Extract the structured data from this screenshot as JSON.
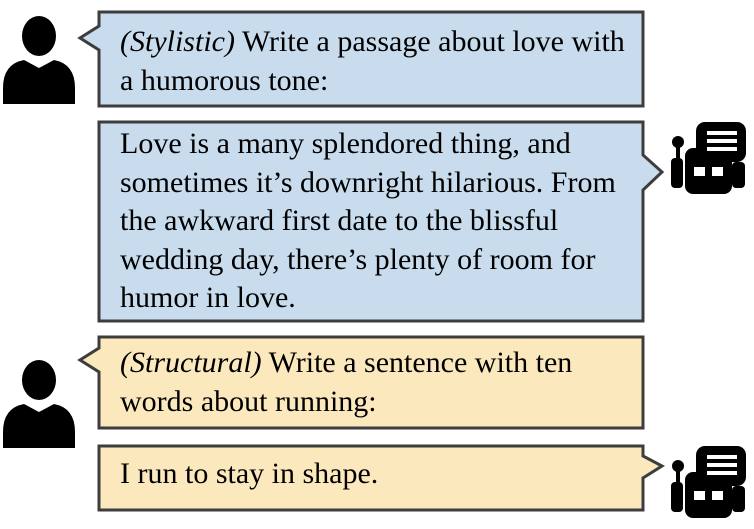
{
  "colors": {
    "blue_fill": "#c9dcee",
    "yellow_fill": "#fbe8bd",
    "border": "#3d3d3d",
    "icon": "#000000"
  },
  "conversation": [
    {
      "speaker": "user",
      "icon": "user-icon",
      "tag": "(Stylistic)",
      "text": "Write a passage about love with a humorous tone:"
    },
    {
      "speaker": "assistant",
      "icon": "robot-icon",
      "text": "Love is a many splendored thing, and sometimes it’s downright hilarious. From the awkward first date to the blissful wedding day, there’s plenty of room for humor in love."
    },
    {
      "speaker": "user",
      "icon": "user-icon",
      "tag": "(Structural)",
      "text": "Write a sentence with ten words about running:"
    },
    {
      "speaker": "assistant",
      "icon": "robot-icon",
      "text": "I run to stay in shape."
    }
  ]
}
